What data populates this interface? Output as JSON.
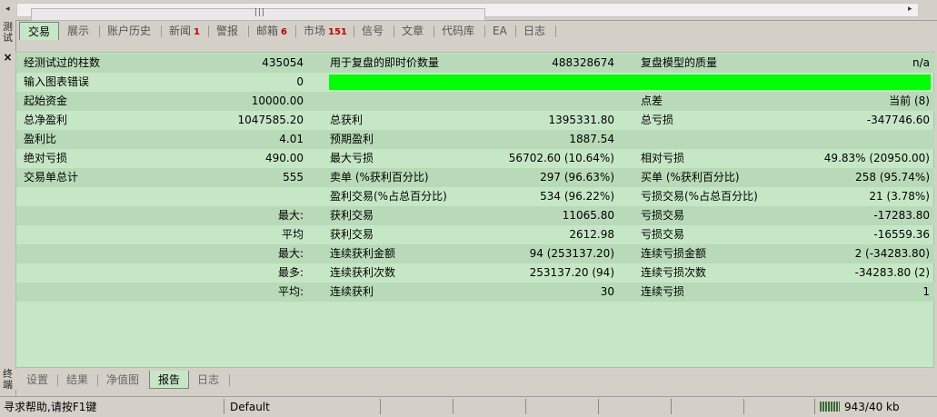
{
  "window": {
    "left_strip_top": "测试",
    "left_strip_bottom": "终端"
  },
  "top_tabs": [
    {
      "label": "交易",
      "badge": ""
    },
    {
      "label": "展示",
      "badge": ""
    },
    {
      "label": "账户历史",
      "badge": ""
    },
    {
      "label": "新闻",
      "badge": "1"
    },
    {
      "label": "警报",
      "badge": ""
    },
    {
      "label": "邮箱",
      "badge": "6"
    },
    {
      "label": "市场",
      "badge": "151"
    },
    {
      "label": "信号",
      "badge": ""
    },
    {
      "label": "文章",
      "badge": ""
    },
    {
      "label": "代码库",
      "badge": ""
    },
    {
      "label": "EA",
      "badge": ""
    },
    {
      "label": "日志",
      "badge": ""
    }
  ],
  "active_top_tab": "交易",
  "report": {
    "bars_tested_label": "经测试过的柱数",
    "bars_tested_value": "435054",
    "ticks_label": "用于复盘的即时价数量",
    "ticks_value": "488328674",
    "model_quality_label": "复盘模型的质量",
    "model_quality_value": "n/a",
    "chart_errors_label": "输入图表错误",
    "chart_errors_value": "0",
    "initial_deposit_label": "起始资金",
    "initial_deposit_value": "10000.00",
    "spread_label": "点差",
    "spread_value": "当前 (8)",
    "net_profit_label": "总净盈利",
    "net_profit_value": "1047585.20",
    "gross_profit_label": "总获利",
    "gross_profit_value": "1395331.80",
    "gross_loss_label": "总亏损",
    "gross_loss_value": "-347746.60",
    "profit_factor_label": "盈利比",
    "profit_factor_value": "4.01",
    "expected_payoff_label": "预期盈利",
    "expected_payoff_value": "1887.54",
    "abs_drawdown_label": "绝对亏损",
    "abs_drawdown_value": "490.00",
    "max_drawdown_label": "最大亏损",
    "max_drawdown_value": "56702.60 (10.64%)",
    "rel_drawdown_label": "相对亏损",
    "rel_drawdown_value": "49.83% (20950.00)",
    "total_trades_label": "交易单总计",
    "total_trades_value": "555",
    "short_label": "卖单 (%获利百分比)",
    "short_value": "297 (96.63%)",
    "long_label": "买单 (%获利百分比)",
    "long_value": "258 (95.74%)",
    "profit_trades_label": "盈利交易(%占总百分比)",
    "profit_trades_value": "534 (96.22%)",
    "loss_trades_label": "亏损交易(%占总百分比)",
    "loss_trades_value": "21 (3.78%)",
    "largest_label": "最大:",
    "largest_profit_label": "获利交易",
    "largest_profit_value": "11065.80",
    "largest_loss_label": "亏损交易",
    "largest_loss_value": "-17283.80",
    "average_label": "平均",
    "average_profit_label": "获利交易",
    "average_profit_value": "2612.98",
    "average_loss_label": "亏损交易",
    "average_loss_value": "-16559.36",
    "max_label": "最大:",
    "max_consec_wins_money_label": "连续获利金额",
    "max_consec_wins_money_value": "94 (253137.20)",
    "max_consec_losses_money_label": "连续亏损金额",
    "max_consec_losses_money_value": "2 (-34283.80)",
    "most_label": "最多:",
    "max_consec_wins_count_label": "连续获利次数",
    "max_consec_wins_count_value": "253137.20 (94)",
    "max_consec_losses_count_label": "连续亏损次数",
    "max_consec_losses_count_value": "-34283.80 (2)",
    "avg_label": "平均:",
    "avg_consec_wins_label": "连续获利",
    "avg_consec_wins_value": "30",
    "avg_consec_losses_label": "连续亏损",
    "avg_consec_losses_value": "1"
  },
  "bottom_tabs": [
    "设置",
    "结果",
    "净值图",
    "报告",
    "日志"
  ],
  "active_bottom_tab": "报告",
  "statusbar": {
    "help_text": "寻求帮助,请按F1键",
    "profile": "Default",
    "traffic": "943/40 kb"
  },
  "colors": {
    "panel_bg": "#c6e7c6",
    "row_alt": "#b8dab8",
    "quality_bar": "#00ff00",
    "badge": "#c00000"
  },
  "icons": [
    "close-icon",
    "scroll-left-icon",
    "scroll-right-icon",
    "traffic-meter-icon"
  ]
}
